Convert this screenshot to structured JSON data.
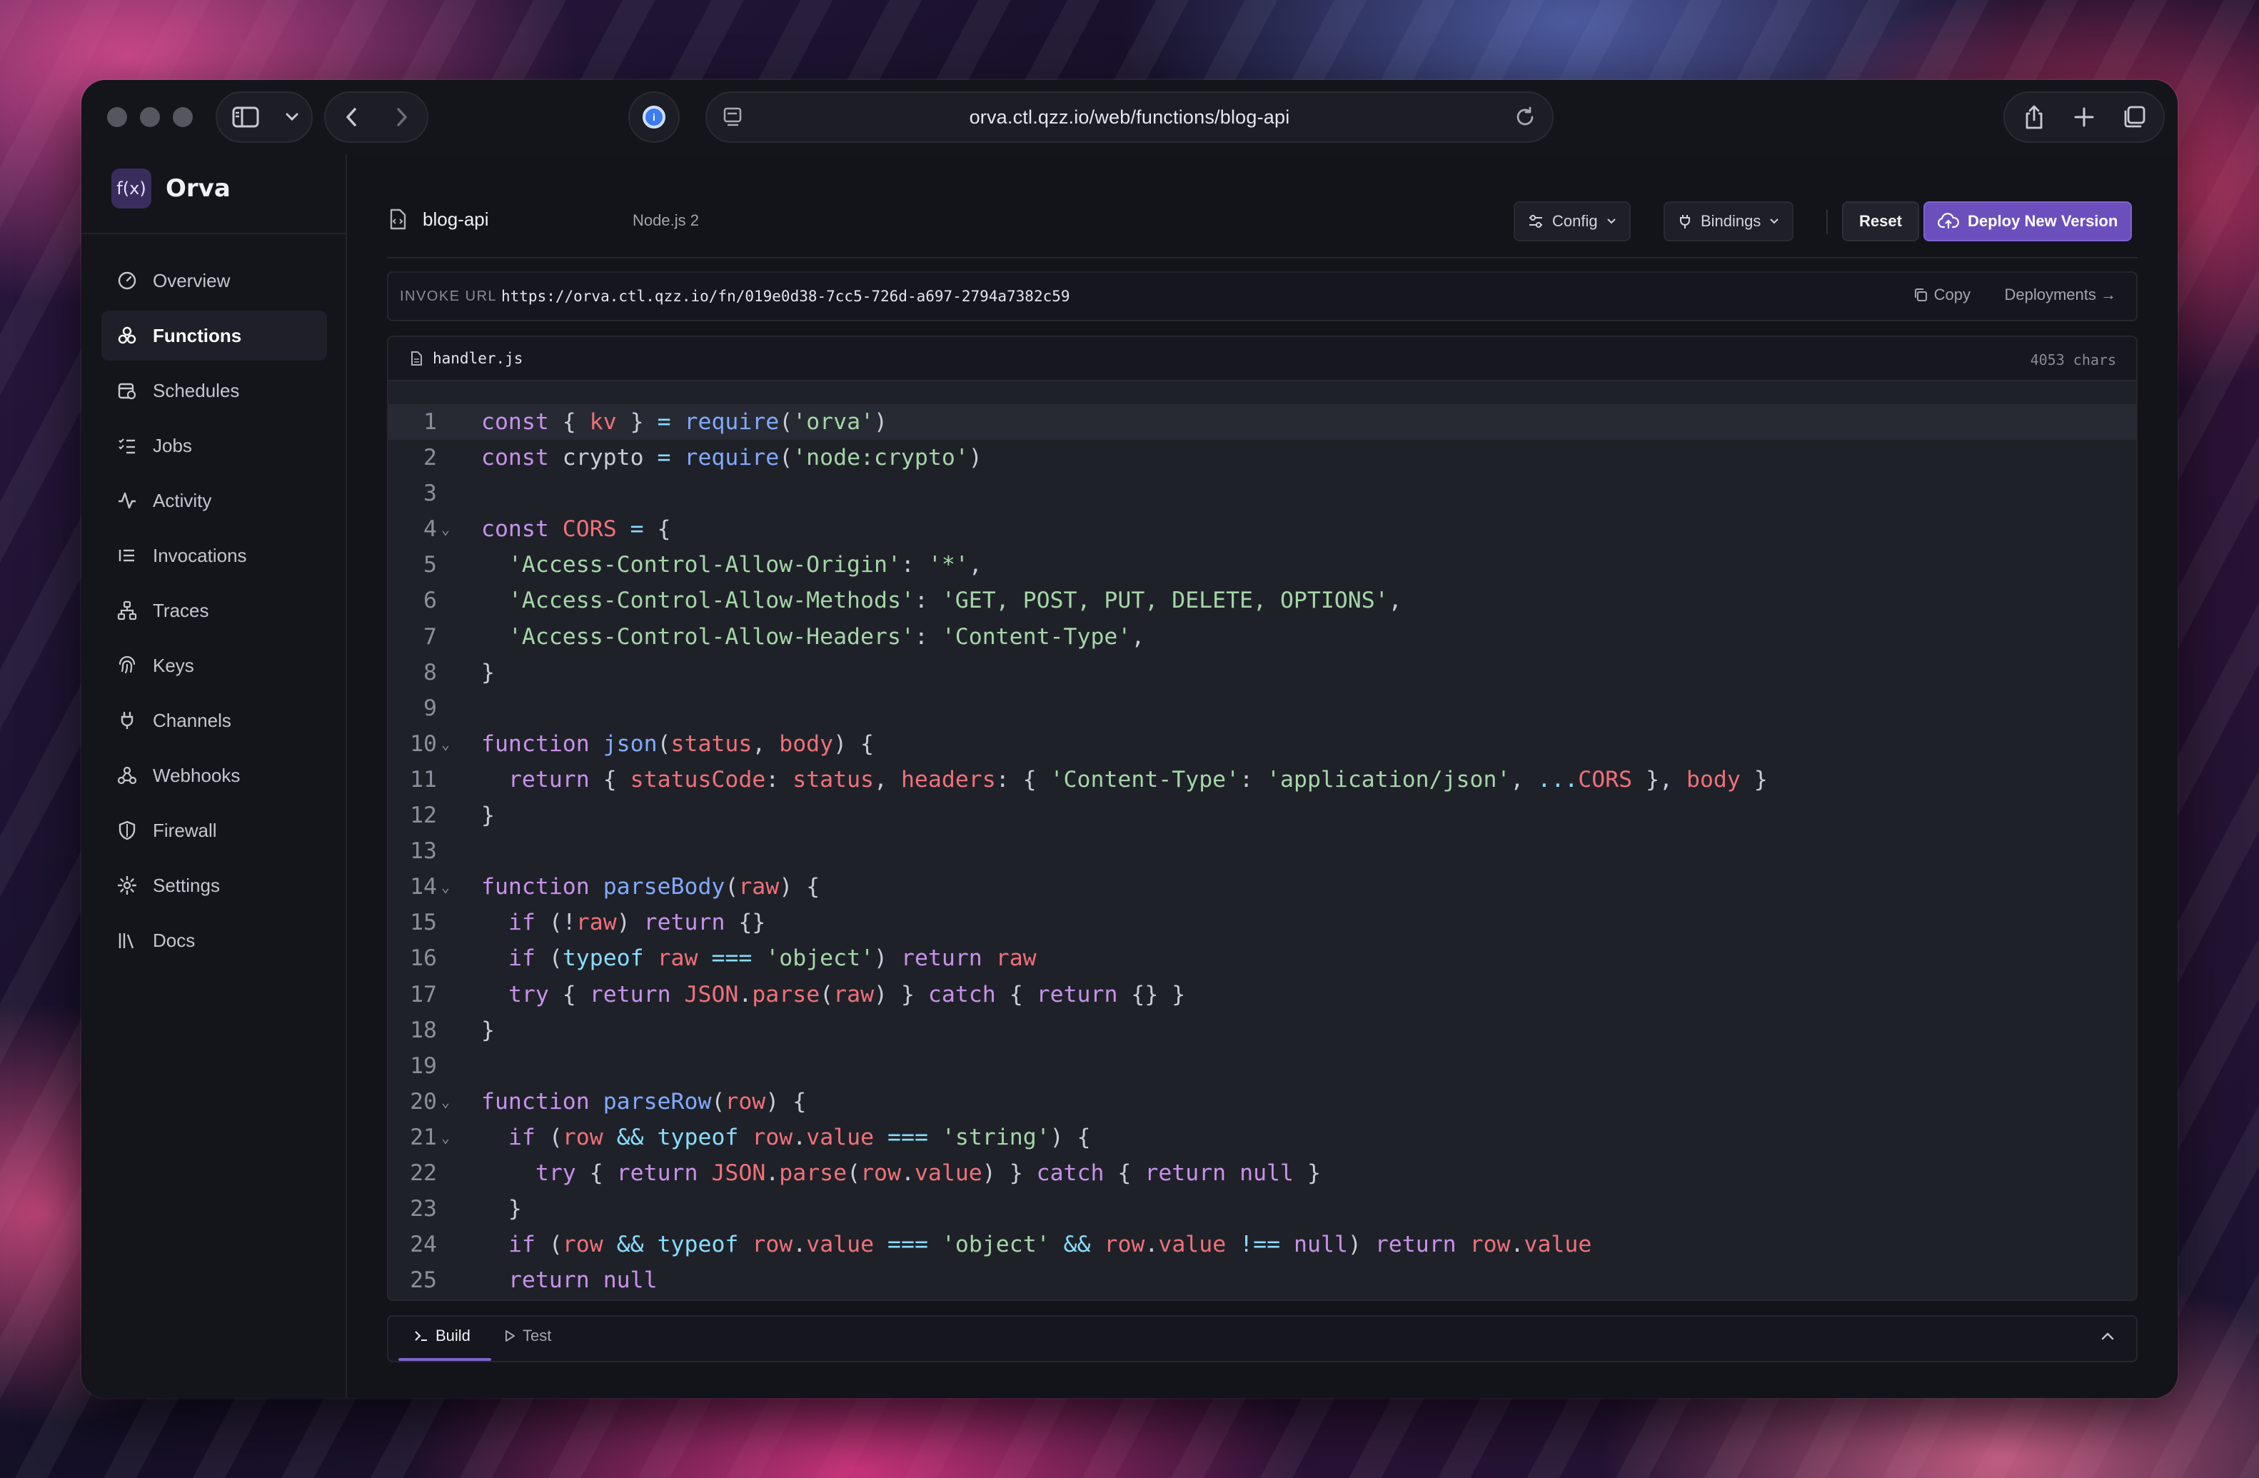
{
  "browser": {
    "url": "orva.ctl.qzz.io/web/functions/blog-api"
  },
  "brand": {
    "logo": "f(x)",
    "name": "Orva"
  },
  "sidebar": {
    "items": [
      {
        "label": "Overview",
        "icon": "gauge-icon"
      },
      {
        "label": "Functions",
        "icon": "functions-icon",
        "active": true
      },
      {
        "label": "Schedules",
        "icon": "calendar-clock-icon"
      },
      {
        "label": "Jobs",
        "icon": "list-checks-icon"
      },
      {
        "label": "Activity",
        "icon": "activity-icon"
      },
      {
        "label": "Invocations",
        "icon": "list-icon"
      },
      {
        "label": "Traces",
        "icon": "network-icon"
      },
      {
        "label": "Keys",
        "icon": "fingerprint-icon"
      },
      {
        "label": "Channels",
        "icon": "plug-icon"
      },
      {
        "label": "Webhooks",
        "icon": "webhook-icon"
      },
      {
        "label": "Firewall",
        "icon": "shield-icon"
      },
      {
        "label": "Settings",
        "icon": "gear-icon"
      },
      {
        "label": "Docs",
        "icon": "library-icon"
      }
    ]
  },
  "header": {
    "function_name": "blog-api",
    "runtime": "Node.js 2",
    "config_label": "Config",
    "bindings_label": "Bindings",
    "reset_label": "Reset",
    "deploy_label": "Deploy New Version"
  },
  "invoke": {
    "label": "INVOKE URL",
    "url": "https://orva.ctl.qzz.io/fn/019e0d38-7cc5-726d-a697-2794a7382c59",
    "copy_label": "Copy",
    "deployments_label": "Deployments →"
  },
  "editor": {
    "filename": "handler.js",
    "chars": "4053 chars",
    "lines": [
      "const { kv } = require('orva')",
      "const crypto = require('node:crypto')",
      "",
      "const CORS = {",
      "  'Access-Control-Allow-Origin': '*',",
      "  'Access-Control-Allow-Methods': 'GET, POST, PUT, DELETE, OPTIONS',",
      "  'Access-Control-Allow-Headers': 'Content-Type',",
      "}",
      "",
      "function json(status, body) {",
      "  return { statusCode: status, headers: { 'Content-Type': 'application/json', ...CORS }, body }",
      "}",
      "",
      "function parseBody(raw) {",
      "  if (!raw) return {}",
      "  if (typeof raw === 'object') return raw",
      "  try { return JSON.parse(raw) } catch { return {} }",
      "}",
      "",
      "function parseRow(row) {",
      "  if (row && typeof row.value === 'string') {",
      "    try { return JSON.parse(row.value) } catch { return null }",
      "  }",
      "  if (row && typeof row.value === 'object' && row.value !== null) return row.value",
      "  return null"
    ],
    "folds": [
      4,
      10,
      14,
      20,
      21
    ]
  },
  "bottom": {
    "build_label": "Build",
    "test_label": "Test"
  }
}
